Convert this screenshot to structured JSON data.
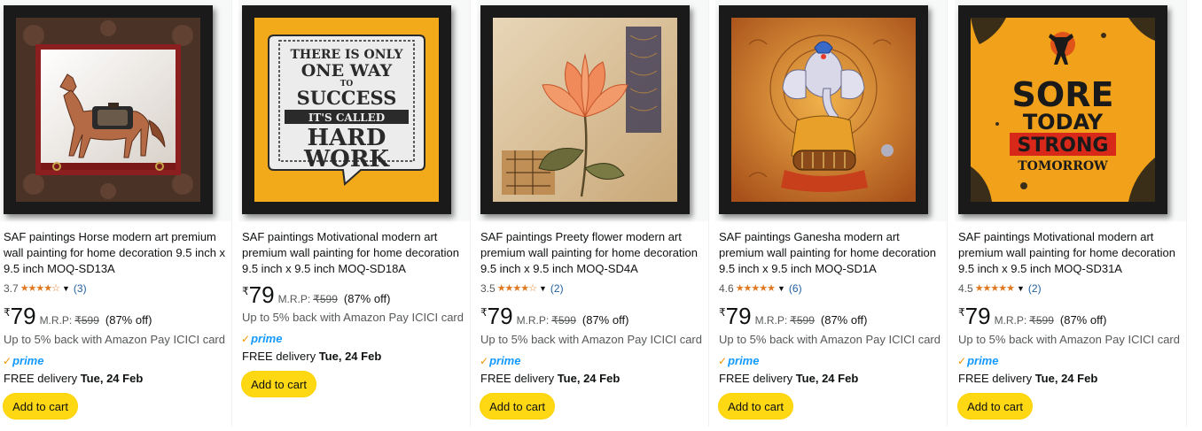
{
  "products": [
    {
      "title": "SAF paintings Horse modern art premium wall painting for home decoration 9.5 inch x 9.5 inch MOQ-SD13A",
      "rating": "3.7",
      "stars": "★★★★☆",
      "review_count": "(3)",
      "currency": "₹",
      "price": "79",
      "mrp_label": "M.R.P:",
      "mrp": "₹599",
      "discount": "(87% off)",
      "cashback": "Up to 5% back with Amazon Pay ICICI card",
      "prime": "prime",
      "delivery_label": "FREE delivery",
      "delivery_date": "Tue, 24 Feb",
      "cart_label": "Add to cart",
      "image": "horse-painting"
    },
    {
      "title": "SAF paintings Motivational modern art premium wall painting for home decoration 9.5 inch x 9.5 inch MOQ-SD18A",
      "rating": "",
      "stars": "",
      "review_count": "",
      "currency": "₹",
      "price": "79",
      "mrp_label": "M.R.P:",
      "mrp": "₹599",
      "discount": "(87% off)",
      "cashback": "Up to 5% back with Amazon Pay ICICI card",
      "prime": "prime",
      "delivery_label": "FREE delivery",
      "delivery_date": "Tue, 24 Feb",
      "cart_label": "Add to cart",
      "image": "success-quote",
      "art_text": [
        "THERE IS ONLY",
        "ONE WAY",
        "TO",
        "SUCCESS",
        "IT'S CALLED",
        "HARD",
        "WORK"
      ]
    },
    {
      "title": "SAF paintings Preety flower modern art premium wall painting for home decoration 9.5 inch x 9.5 inch MOQ-SD4A",
      "rating": "3.5",
      "stars": "★★★★☆",
      "review_count": "(2)",
      "currency": "₹",
      "price": "79",
      "mrp_label": "M.R.P:",
      "mrp": "₹599",
      "discount": "(87% off)",
      "cashback": "Up to 5% back with Amazon Pay ICICI card",
      "prime": "prime",
      "delivery_label": "FREE delivery",
      "delivery_date": "Tue, 24 Feb",
      "cart_label": "Add to cart",
      "image": "flower-painting"
    },
    {
      "title": "SAF paintings Ganesha modern art premium wall painting for home decoration 9.5 inch x 9.5 inch MOQ-SD1A",
      "rating": "4.6",
      "stars": "★★★★★",
      "review_count": "(6)",
      "currency": "₹",
      "price": "79",
      "mrp_label": "M.R.P:",
      "mrp": "₹599",
      "discount": "(87% off)",
      "cashback": "Up to 5% back with Amazon Pay ICICI card",
      "prime": "prime",
      "delivery_label": "FREE delivery",
      "delivery_date": "Tue, 24 Feb",
      "cart_label": "Add to cart",
      "image": "ganesha-painting"
    },
    {
      "title": "SAF paintings Motivational modern art premium wall painting for home decoration 9.5 inch x 9.5 inch MOQ-SD31A",
      "rating": "4.5",
      "stars": "★★★★★",
      "review_count": "(2)",
      "currency": "₹",
      "price": "79",
      "mrp_label": "M.R.P:",
      "mrp": "₹599",
      "discount": "(87% off)",
      "cashback": "Up to 5% back with Amazon Pay ICICI card",
      "prime": "prime",
      "delivery_label": "FREE delivery",
      "delivery_date": "Tue, 24 Feb",
      "cart_label": "Add to cart",
      "image": "sore-today-quote",
      "art_text": [
        "SORE",
        "TODAY",
        "STRONG",
        "TOMORROW"
      ]
    }
  ],
  "colors": {
    "accent_button": "#ffd814",
    "star": "#de7921",
    "link": "#2162a1",
    "prime": "#1399ff"
  }
}
